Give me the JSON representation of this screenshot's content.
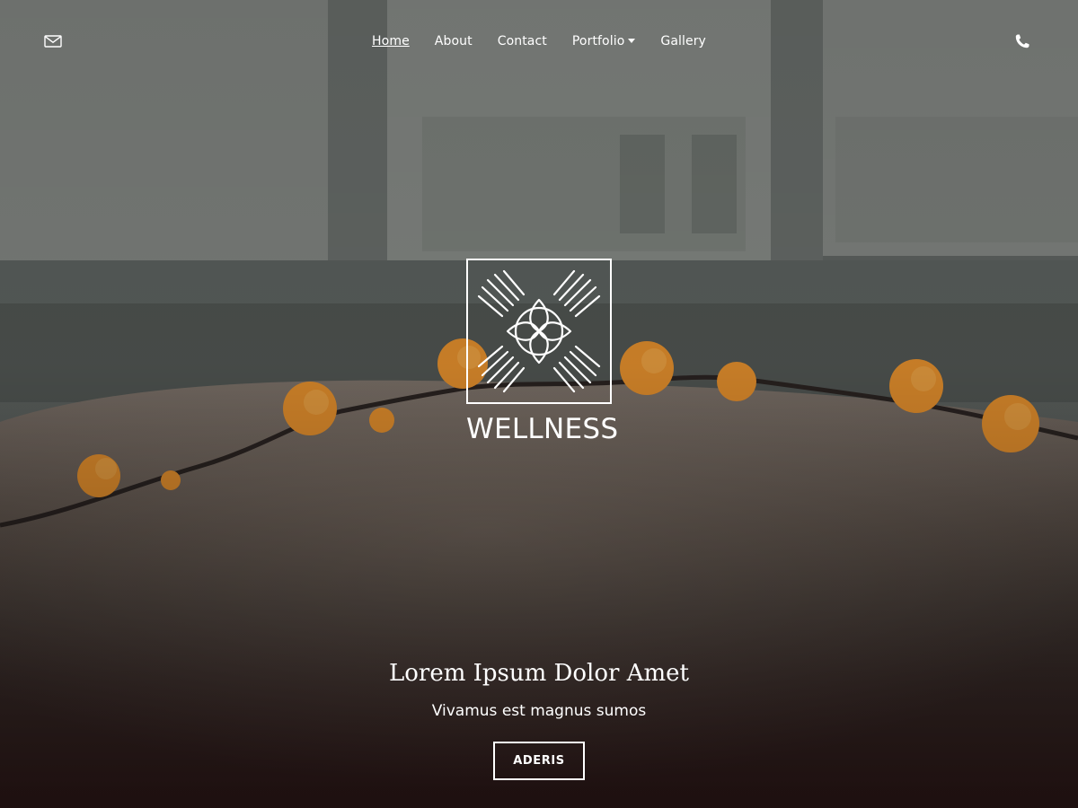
{
  "nav": {
    "items": [
      {
        "label": "Home",
        "active": true
      },
      {
        "label": "About"
      },
      {
        "label": "Contact"
      },
      {
        "label": "Portfolio",
        "has_dropdown": true
      },
      {
        "label": "Gallery"
      }
    ],
    "left_icon": "mail-icon",
    "right_icon": "phone-icon"
  },
  "logo": {
    "icon": "hands-flower-icon",
    "text": "WELLNESS"
  },
  "hero": {
    "title": "Lorem Ipsum Dolor Amet",
    "subtitle": "Vivamus est magnus sumos",
    "button_label": "ADERIS"
  },
  "colors": {
    "text": "#ffffff",
    "flower": "#e8922e"
  }
}
